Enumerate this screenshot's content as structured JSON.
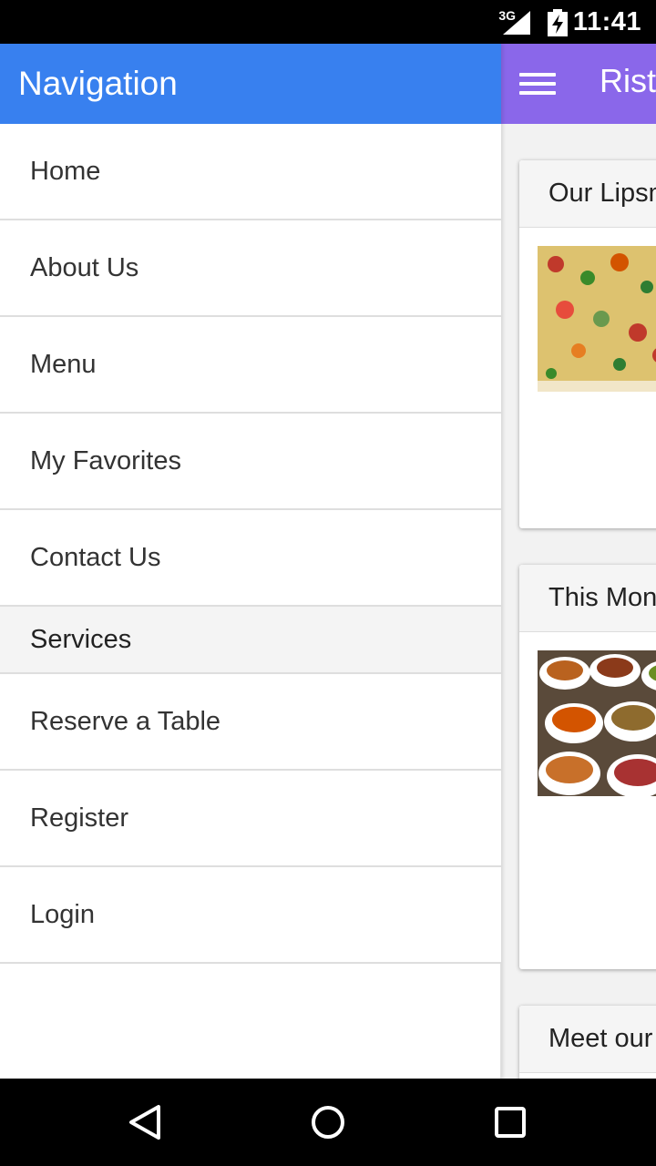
{
  "status_bar": {
    "network_type": "3G",
    "time": "11:41"
  },
  "main_app": {
    "title": "Ristorante Con Fusion",
    "toolbar_color": "#8a67ea",
    "cards": [
      {
        "header": "Our Lipsmacking Culinary Creations"
      },
      {
        "header": "This Month's Promotions"
      },
      {
        "header": "Meet our Culinary Specialists"
      }
    ]
  },
  "drawer": {
    "header_title": "Navigation",
    "header_color": "#3880ef",
    "items_top": [
      {
        "label": "Home"
      },
      {
        "label": "About Us"
      },
      {
        "label": "Menu"
      },
      {
        "label": "My Favorites"
      },
      {
        "label": "Contact Us"
      }
    ],
    "section_label": "Services",
    "items_bottom": [
      {
        "label": "Reserve a Table"
      },
      {
        "label": "Register"
      },
      {
        "label": "Login"
      }
    ]
  },
  "system_nav": {
    "back_icon": "back-triangle-icon",
    "home_icon": "home-circle-icon",
    "recents_icon": "recents-square-icon"
  }
}
